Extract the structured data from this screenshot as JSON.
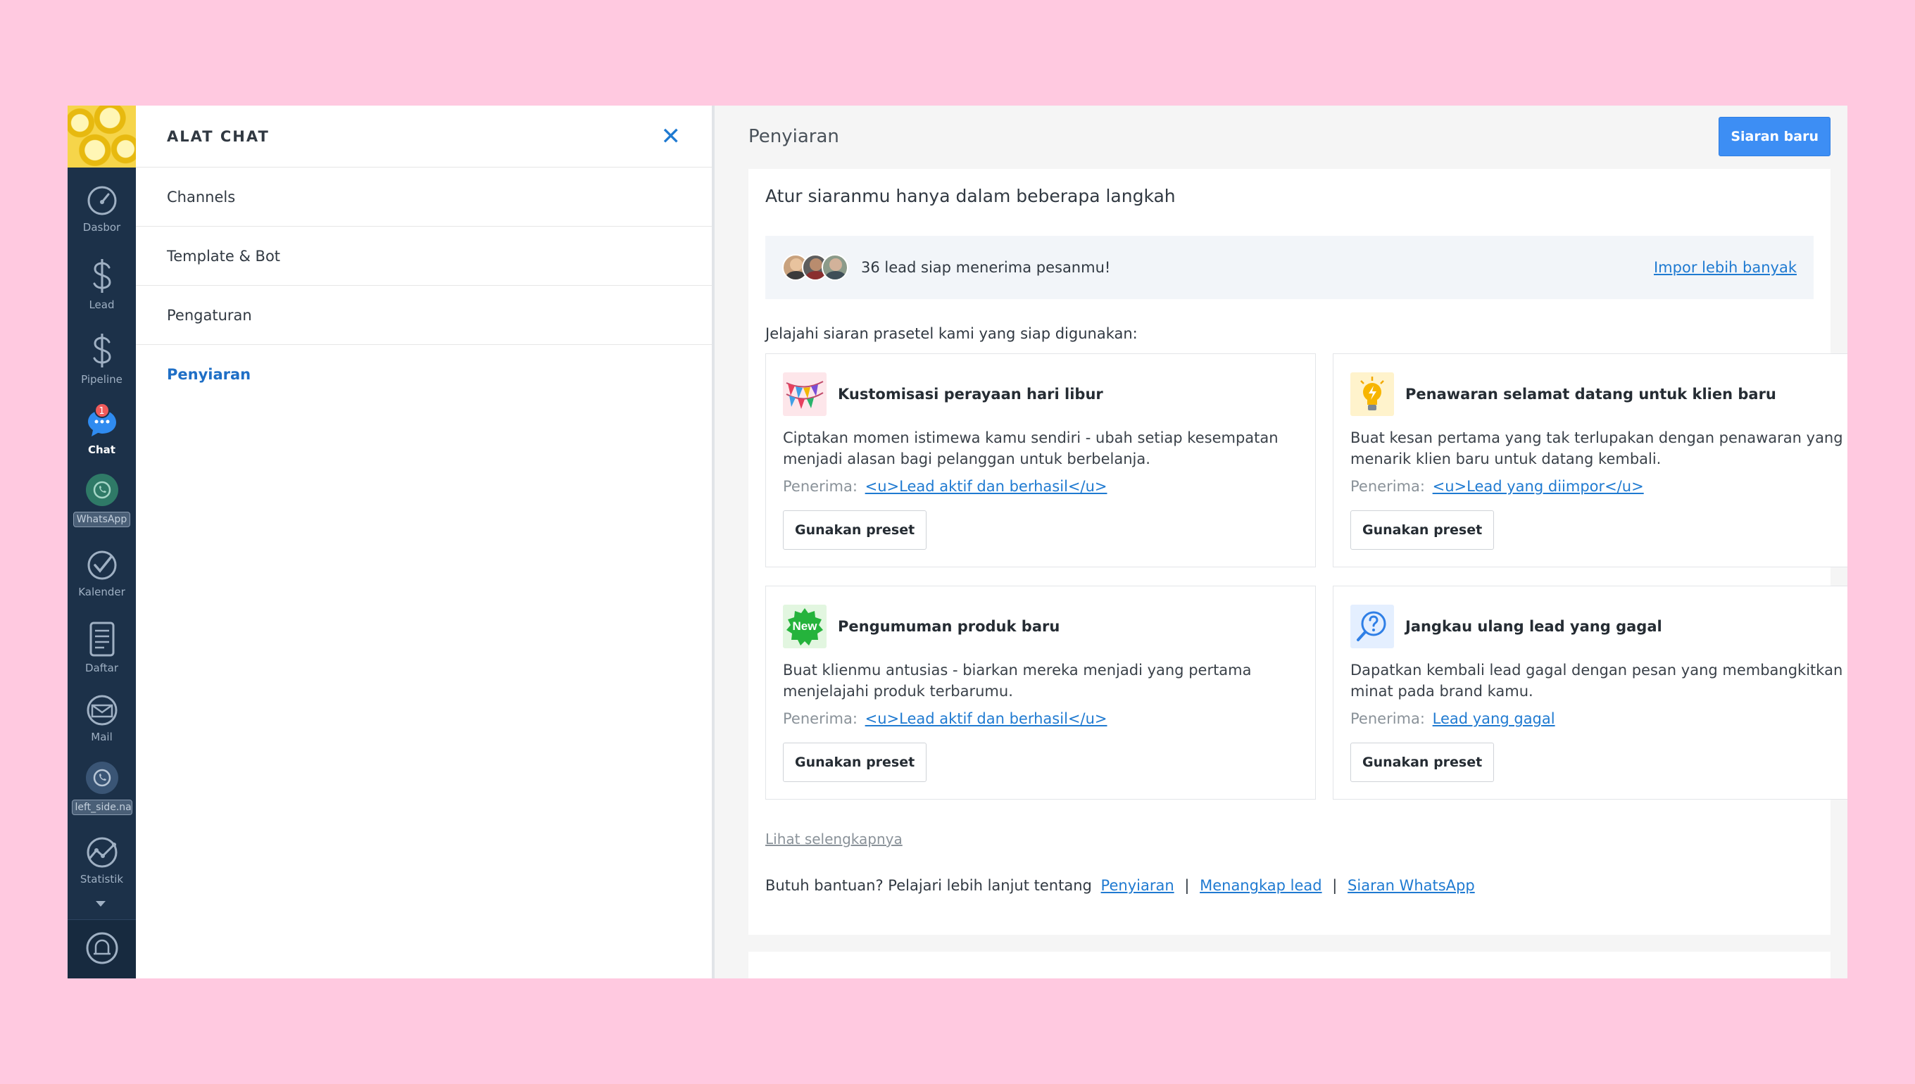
{
  "nav": {
    "items": [
      {
        "label": "Dasbor",
        "icon": "speedometer-icon"
      },
      {
        "label": "Lead",
        "icon": "dollar-icon"
      },
      {
        "label": "Pipeline",
        "icon": "dollar-icon"
      },
      {
        "label": "Chat",
        "icon": "chat-icon",
        "badge": "1",
        "active": true
      },
      {
        "label": "WhatsApp",
        "icon": "whatsapp-icon"
      },
      {
        "label": "Kalender",
        "icon": "check-circle-icon"
      },
      {
        "label": "Daftar",
        "icon": "list-icon"
      },
      {
        "label": "Mail",
        "icon": "mail-icon"
      },
      {
        "label": "left_side.na",
        "icon": "whatsapp-icon"
      },
      {
        "label": "Statistik",
        "icon": "chart-icon"
      }
    ]
  },
  "panel": {
    "title": "ALAT CHAT",
    "items": [
      "Channels",
      "Template & Bot",
      "Pengaturan",
      "Penyiaran"
    ]
  },
  "main": {
    "title": "Penyiaran",
    "new_button": "Siaran baru",
    "card_title": "Atur siaranmu hanya dalam beberapa langkah",
    "leads_text": "36 lead siap menerima pesanmu!",
    "import_link": "Impor lebih banyak",
    "explore_text": "Jelajahi siaran prasetel kami yang siap digunakan:",
    "recipient_label": "Penerima:",
    "use_preset": "Gunakan preset",
    "presets": [
      {
        "title": "Kustomisasi perayaan hari libur",
        "desc": "Ciptakan momen istimewa kamu sendiri - ubah setiap kesempatan menjadi alasan bagi pelanggan untuk berbelanja.",
        "recipient": "<u>Lead aktif dan berhasil</u>",
        "icon": "party-flags-icon"
      },
      {
        "title": "Penawaran selamat datang untuk klien baru",
        "desc": "Buat kesan pertama yang tak terlupakan dengan penawaran yang menarik klien baru untuk datang kembali.",
        "recipient": "<u>Lead yang diimpor</u>",
        "icon": "lightbulb-icon"
      },
      {
        "title": "Pengumuman produk baru",
        "desc": "Buat klienmu antusias - biarkan mereka menjadi yang pertama menjelajahi produk terbarumu.",
        "recipient": "<u>Lead aktif dan berhasil</u>",
        "icon": "new-badge-icon",
        "icon_text": "New"
      },
      {
        "title": "Jangkau ulang lead yang gagal",
        "desc": "Dapatkan kembali lead gagal dengan pesan yang membangkitkan minat pada brand kamu.",
        "recipient": "Lead yang gagal",
        "icon": "search-question-icon"
      }
    ],
    "see_more": "Lihat selengkapnya",
    "help_text": "Butuh bantuan? Pelajari lebih lanjut tentang",
    "help_links": [
      "Penyiaran",
      "Menangkap lead",
      "Siaran WhatsApp"
    ],
    "help_sep": "|"
  },
  "colors": {
    "background": "#ffc9e0",
    "nav": "#1c3149",
    "accent": "#3d8ef4",
    "link": "#1f7ad1"
  }
}
